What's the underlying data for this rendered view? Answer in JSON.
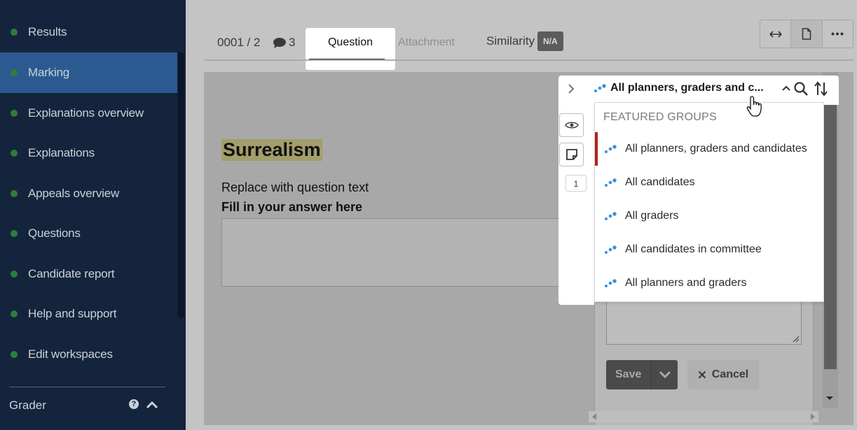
{
  "sidebar": {
    "items": [
      {
        "label": "Results"
      },
      {
        "label": "Marking"
      },
      {
        "label": "Explanations overview"
      },
      {
        "label": "Explanations"
      },
      {
        "label": "Appeals overview"
      },
      {
        "label": "Questions"
      },
      {
        "label": "Candidate report"
      },
      {
        "label": "Help and support"
      },
      {
        "label": "Edit workspaces"
      }
    ],
    "active_index": 1,
    "footer_label": "Grader",
    "help_glyph": "?"
  },
  "topbar": {
    "counter": "0001 / 2",
    "comment_count": "3",
    "tabs": {
      "question": "Question",
      "attachment": "Attachment"
    },
    "similarity_label": "Similarity",
    "similarity_badge": "N/A",
    "toolbar_icons": [
      "expand-horizontal-icon",
      "document-icon",
      "more-icon"
    ]
  },
  "document": {
    "title": "Surrealism",
    "question_text": "Replace with question text",
    "answer_prompt": "Fill in your answer here"
  },
  "popover": {
    "selected_group": "All planners, graders and c...",
    "side_badge_count": "1",
    "dropdown_header": "FEATURED GROUPS",
    "options": [
      {
        "label": "All planners, graders and candidates",
        "selected": true
      },
      {
        "label": "All candidates",
        "selected": false
      },
      {
        "label": "All graders",
        "selected": false
      },
      {
        "label": "All candidates in committee",
        "selected": false
      },
      {
        "label": "All planners and graders",
        "selected": false
      }
    ]
  },
  "comment_form": {
    "save_label": "Save",
    "cancel_label": "Cancel"
  },
  "colors": {
    "sidebar_bg": "#14243c",
    "sidebar_active": "#2b5a91",
    "status_dot": "#2f7d3a",
    "selected_marker": "#b31e1e",
    "group_icon": "#3b8fd9"
  }
}
